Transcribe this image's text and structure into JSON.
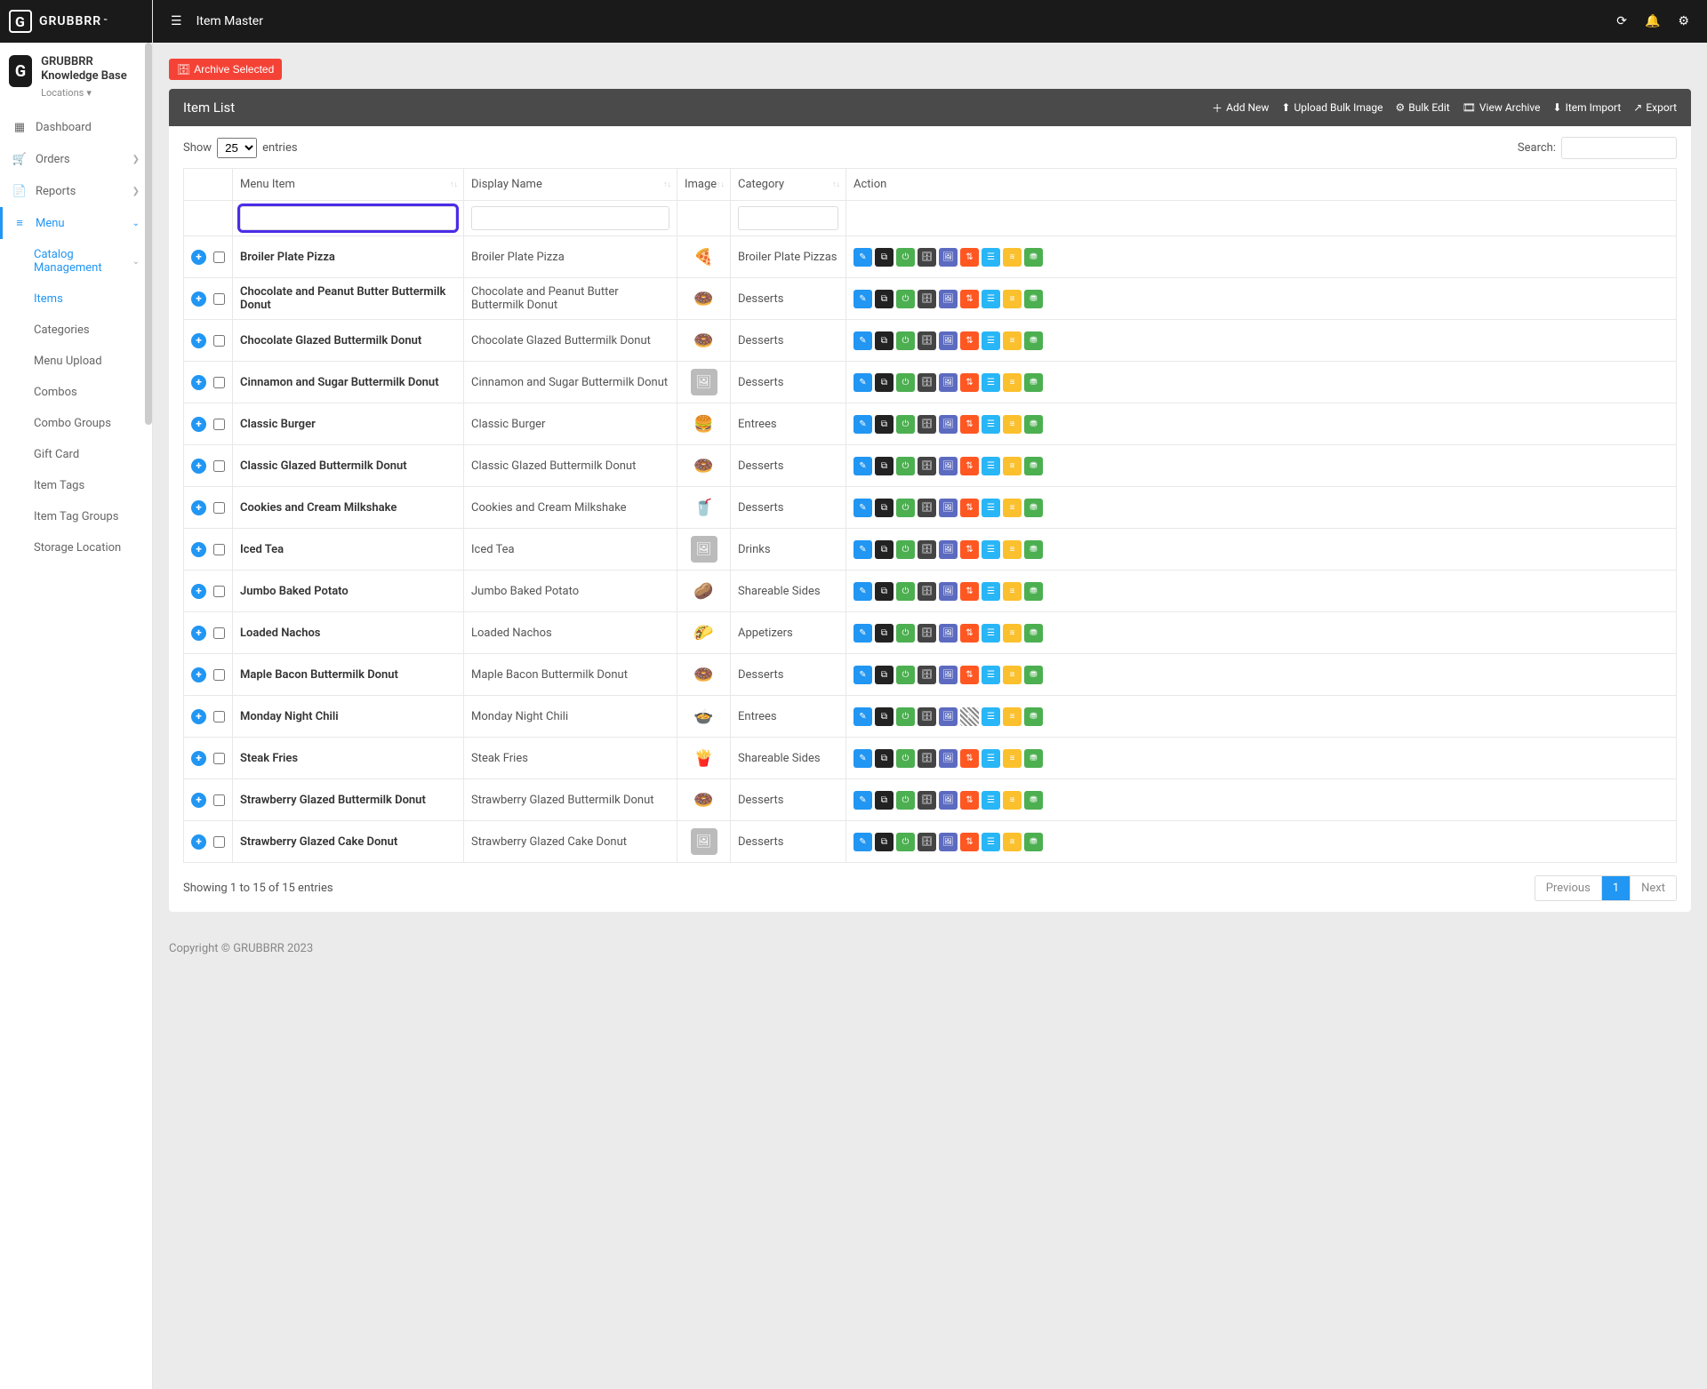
{
  "brand": "GRUBBRR",
  "brand_tm": "™",
  "company": {
    "name": "GRUBBRR Knowledge Base",
    "locations_label": "Locations"
  },
  "topbar": {
    "page_title": "Item Master"
  },
  "nav": {
    "dashboard": "Dashboard",
    "orders": "Orders",
    "reports": "Reports",
    "menu": "Menu",
    "sub": {
      "catalog": "Catalog Management",
      "items": "Items",
      "categories": "Categories",
      "menu_upload": "Menu Upload",
      "combos": "Combos",
      "combo_groups": "Combo Groups",
      "gift_card": "Gift Card",
      "item_tags": "Item Tags",
      "item_tag_groups": "Item Tag Groups",
      "storage_location": "Storage Location"
    }
  },
  "buttons": {
    "archive_selected": "Archive Selected"
  },
  "panel": {
    "title": "Item List",
    "actions": {
      "add_new": "Add New",
      "upload_bulk_image": "Upload Bulk Image",
      "bulk_edit": "Bulk Edit",
      "view_archive": "View Archive",
      "item_import": "Item Import",
      "export": "Export"
    }
  },
  "table_controls": {
    "show": "Show",
    "entries": "entries",
    "page_size": "25",
    "search_label": "Search:"
  },
  "columns": {
    "menu_item": "Menu Item",
    "display_name": "Display Name",
    "image": "Image",
    "category": "Category",
    "action": "Action"
  },
  "rows": [
    {
      "id": 0,
      "name": "Broiler Plate Pizza",
      "display": "Broiler Plate Pizza",
      "category": "Broiler Plate Pizzas",
      "thumb": "🍕",
      "placeholder": false,
      "hatch": false
    },
    {
      "id": 1,
      "name": "Chocolate and Peanut Butter Buttermilk Donut",
      "display": "Chocolate and Peanut Butter Buttermilk Donut",
      "category": "Desserts",
      "thumb": "🍩",
      "placeholder": false,
      "hatch": false
    },
    {
      "id": 2,
      "name": "Chocolate Glazed Buttermilk Donut",
      "display": "Chocolate Glazed Buttermilk Donut",
      "category": "Desserts",
      "thumb": "🍩",
      "placeholder": false,
      "hatch": false
    },
    {
      "id": 3,
      "name": "Cinnamon and Sugar Buttermilk Donut",
      "display": "Cinnamon and Sugar Buttermilk Donut",
      "category": "Desserts",
      "thumb": "",
      "placeholder": true,
      "hatch": false
    },
    {
      "id": 4,
      "name": "Classic Burger",
      "display": "Classic Burger",
      "category": "Entrees",
      "thumb": "🍔",
      "placeholder": false,
      "hatch": false
    },
    {
      "id": 5,
      "name": "Classic Glazed Buttermilk Donut",
      "display": "Classic Glazed Buttermilk Donut",
      "category": "Desserts",
      "thumb": "🍩",
      "placeholder": false,
      "hatch": false
    },
    {
      "id": 6,
      "name": "Cookies and Cream Milkshake",
      "display": "Cookies and Cream Milkshake",
      "category": "Desserts",
      "thumb": "🥤",
      "placeholder": false,
      "hatch": false
    },
    {
      "id": 7,
      "name": "Iced Tea",
      "display": "Iced Tea",
      "category": "Drinks",
      "thumb": "",
      "placeholder": true,
      "hatch": false
    },
    {
      "id": 8,
      "name": "Jumbo Baked Potato",
      "display": "Jumbo Baked Potato",
      "category": "Shareable Sides",
      "thumb": "🥔",
      "placeholder": false,
      "hatch": false
    },
    {
      "id": 9,
      "name": "Loaded Nachos",
      "display": "Loaded Nachos",
      "category": "Appetizers",
      "thumb": "🌮",
      "placeholder": false,
      "hatch": false
    },
    {
      "id": 10,
      "name": "Maple Bacon Buttermilk Donut",
      "display": "Maple Bacon Buttermilk Donut",
      "category": "Desserts",
      "thumb": "🍩",
      "placeholder": false,
      "hatch": false
    },
    {
      "id": 11,
      "name": "Monday Night Chili",
      "display": "Monday Night Chili",
      "category": "Entrees",
      "thumb": "🍲",
      "placeholder": false,
      "hatch": true
    },
    {
      "id": 12,
      "name": "Steak Fries",
      "display": "Steak Fries",
      "category": "Shareable Sides",
      "thumb": "🍟",
      "placeholder": false,
      "hatch": false
    },
    {
      "id": 13,
      "name": "Strawberry Glazed Buttermilk Donut",
      "display": "Strawberry Glazed Buttermilk Donut",
      "category": "Desserts",
      "thumb": "🍩",
      "placeholder": false,
      "hatch": false
    },
    {
      "id": 14,
      "name": "Strawberry Glazed Cake Donut",
      "display": "Strawberry Glazed Cake Donut",
      "category": "Desserts",
      "thumb": "",
      "placeholder": true,
      "hatch": false
    }
  ],
  "footer_info": "Showing 1 to 15 of 15 entries",
  "pagination": {
    "previous": "Previous",
    "current": "1",
    "next": "Next"
  },
  "copyright": "Copyright © GRUBBRR 2023"
}
